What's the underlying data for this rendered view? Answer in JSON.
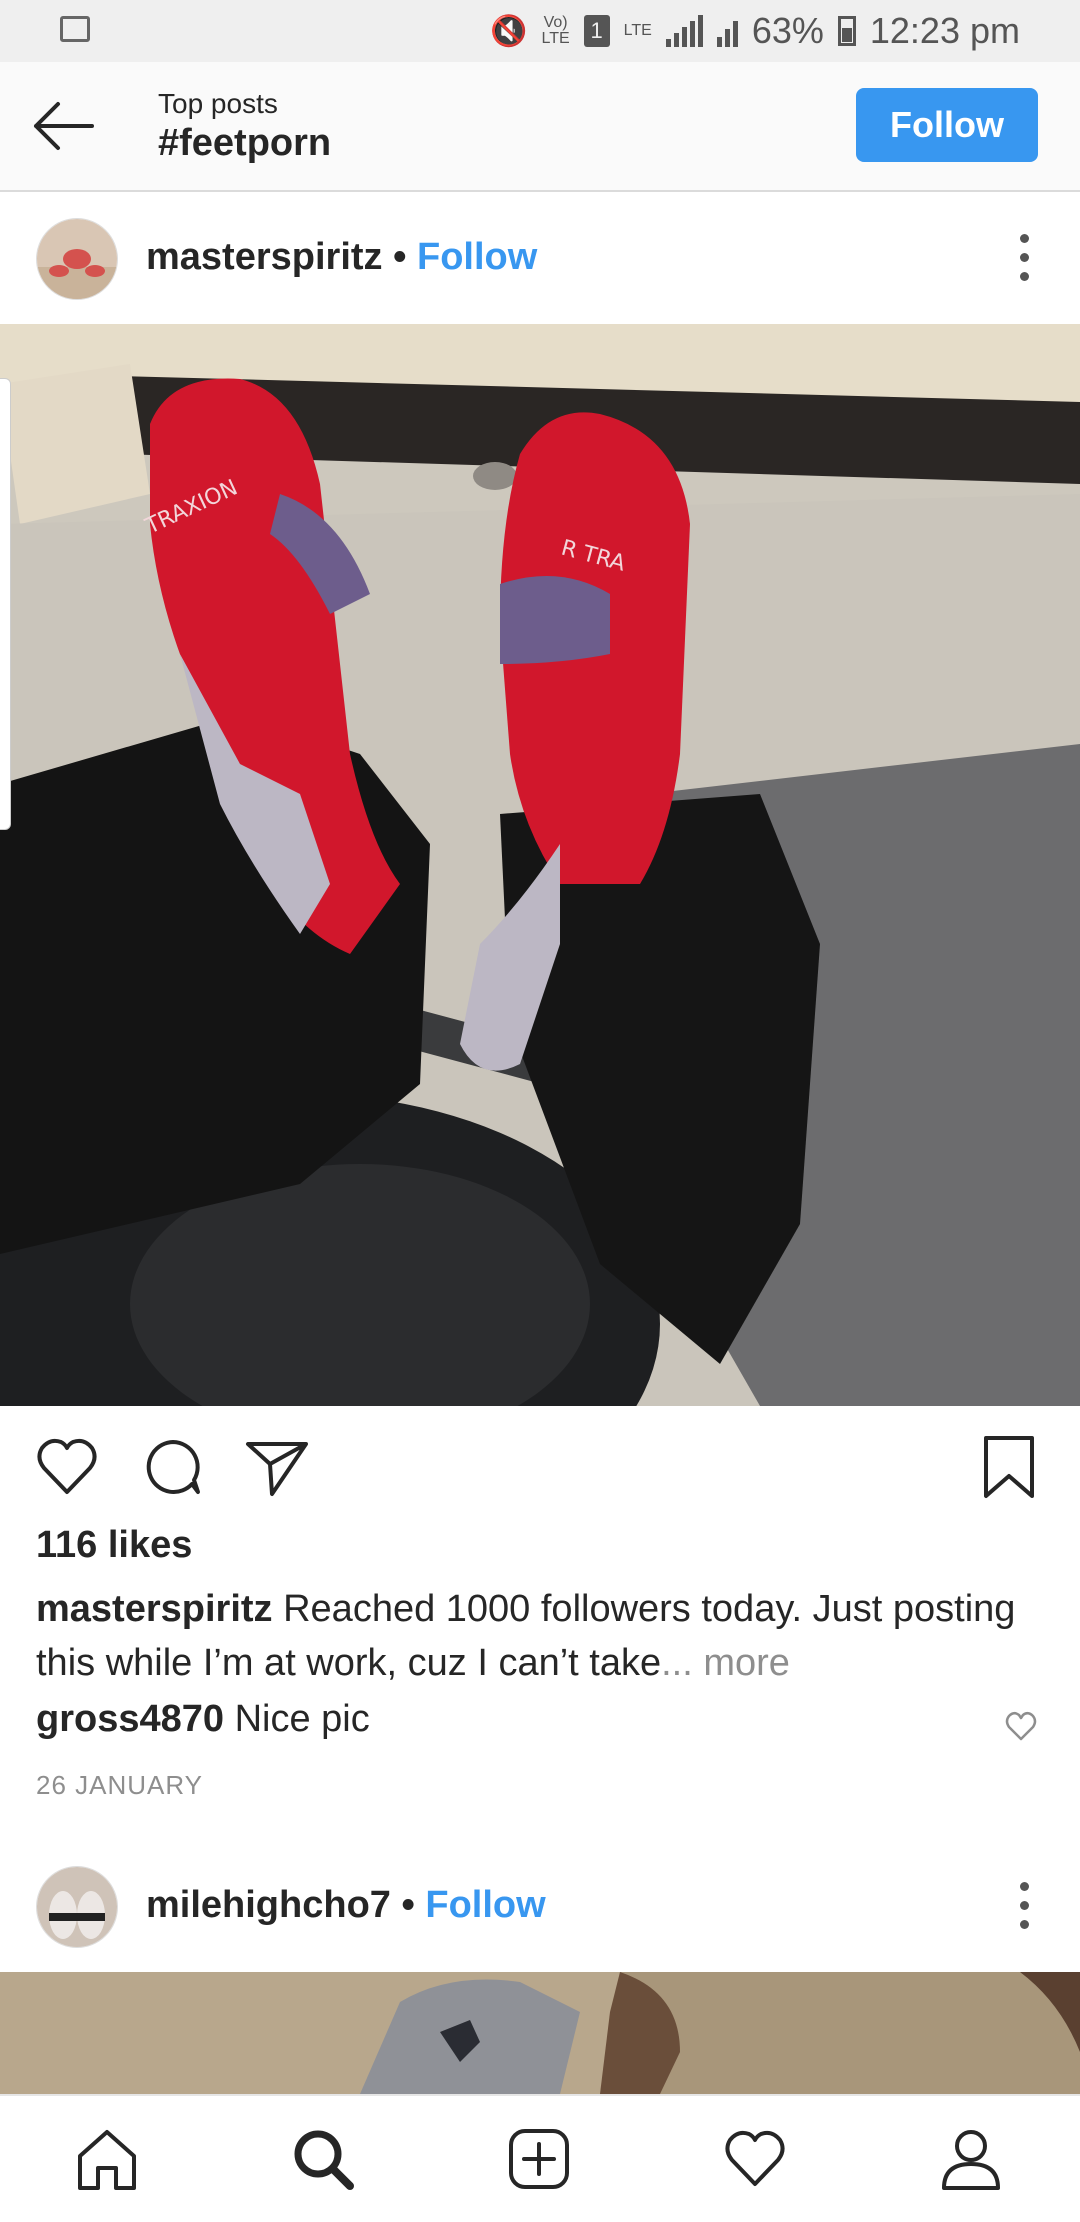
{
  "status_bar": {
    "volte": "Vo)",
    "lte_label": "LTE",
    "sim": "1",
    "lte2": "LTE",
    "battery": "63%",
    "time": "12:23 pm"
  },
  "header": {
    "subtitle": "Top posts",
    "title": "#feetporn",
    "follow_label": "Follow"
  },
  "posts": [
    {
      "username": "masterspiritz",
      "separator": "•",
      "follow_label": "Follow",
      "likes": "116 likes",
      "caption_user": "masterspiritz",
      "caption_text": "Reached 1000 followers today. Just posting this while I’m at work, cuz I can’t take",
      "caption_more": "... more",
      "comment_user": "gross4870",
      "comment_text": "Nice pic",
      "date": "26 JANUARY"
    },
    {
      "username": "milehighcho7",
      "separator": "•",
      "follow_label": "Follow"
    }
  ],
  "icons": {
    "back": "arrow-left",
    "like": "heart-outline",
    "comment": "speech-bubble",
    "share": "paper-plane",
    "save": "bookmark",
    "more": "vertical-dots",
    "nav": [
      "home",
      "search",
      "add-post",
      "activity-heart",
      "profile"
    ]
  },
  "colors": {
    "accent": "#3897f0",
    "text": "#262626",
    "muted": "#8e8e8e"
  }
}
